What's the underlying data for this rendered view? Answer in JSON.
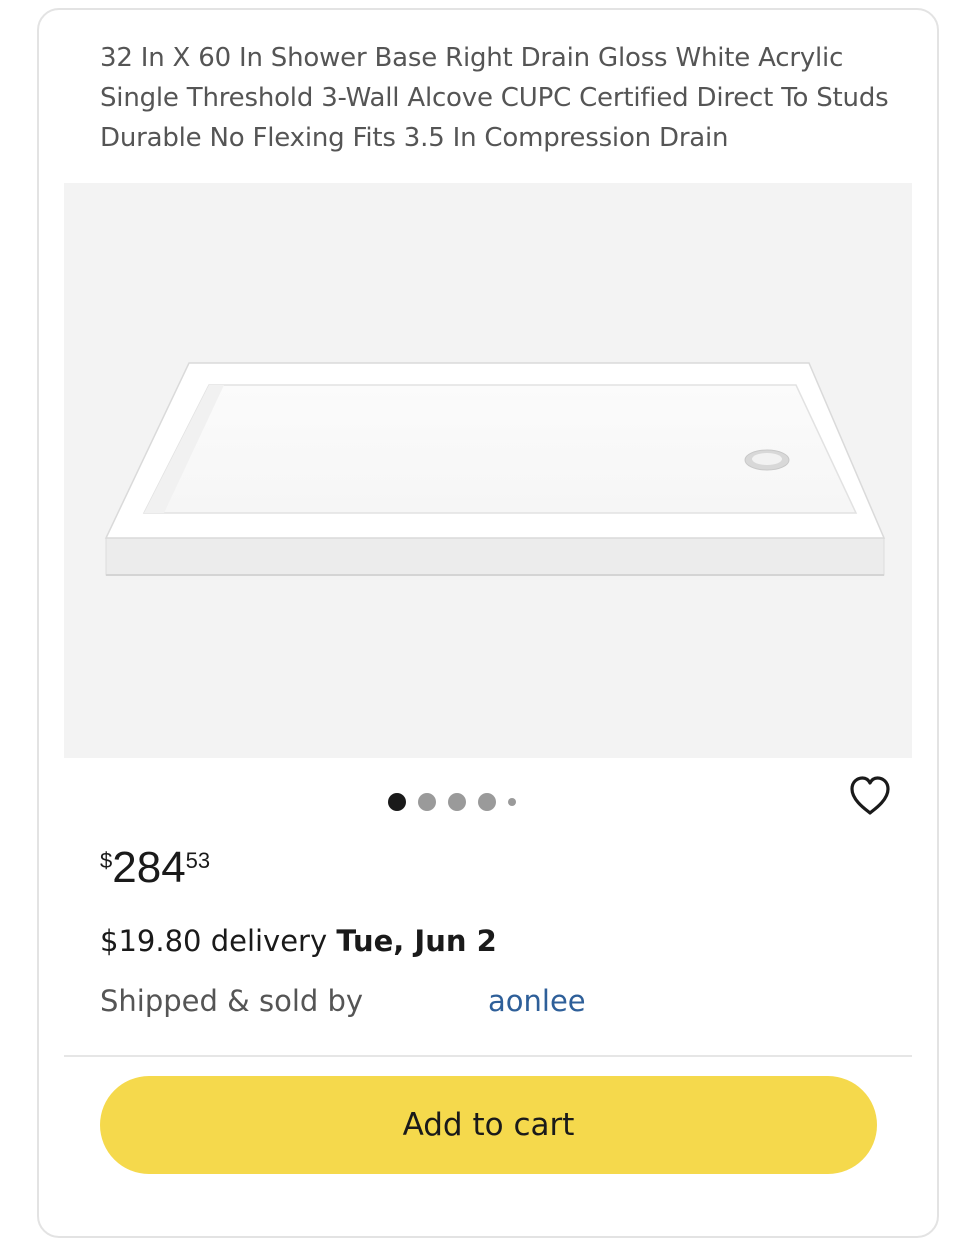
{
  "product": {
    "title": "32 In X 60 In Shower Base Right Drain Gloss White Acrylic Single Threshold 3-Wall Alcove CUPC Certified Direct To Studs Durable No Flexing Fits 3.5 In Compression Drain",
    "image": {
      "icon": "shower-base-product-image"
    },
    "carousel": {
      "total_dots": 5,
      "active_index": 0
    },
    "favorite_icon": "heart-outline-icon"
  },
  "price": {
    "currency": "$",
    "whole": "284",
    "cents": "53"
  },
  "delivery": {
    "fee": "$19.80 delivery",
    "date": "Tue, Jun 2"
  },
  "seller": {
    "label": "Shipped & sold by",
    "name": "aonlee"
  },
  "cart": {
    "button_label": "Add to cart",
    "button_color": "#f5d94c"
  },
  "colors": {
    "link": "#2e5f99",
    "text": "#1a1a1a",
    "muted": "#555555"
  }
}
